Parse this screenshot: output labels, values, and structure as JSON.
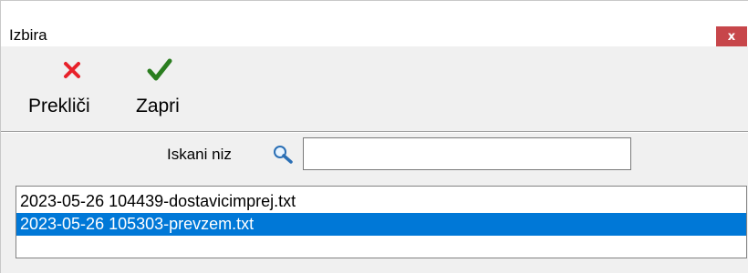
{
  "window": {
    "title": "Izbira",
    "close_label": "x"
  },
  "toolbar": {
    "cancel_label": "Prekliči",
    "cancel_icon": "red-x-icon",
    "close_label": "Zapri",
    "close_icon": "green-check-icon"
  },
  "search": {
    "label": "Iskani niz",
    "value": "",
    "icon": "magnifier-icon"
  },
  "files": {
    "items": [
      {
        "name": "2023-05-26 104439-dostavicimprej.txt",
        "selected": false
      },
      {
        "name": "2023-05-26 105303-prevzem.txt",
        "selected": true
      }
    ]
  },
  "colors": {
    "close_button": "#c7464a",
    "selection": "#0078d7",
    "cancel_icon": "#e8212a",
    "confirm_icon": "#2a7d1f"
  }
}
